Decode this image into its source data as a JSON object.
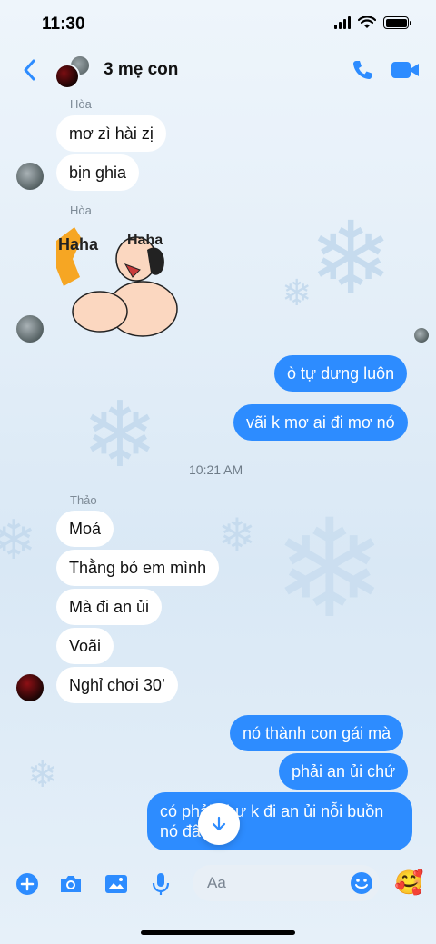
{
  "status_bar": {
    "time": "11:30"
  },
  "header": {
    "title": "3 mẹ con"
  },
  "messages": {
    "hoa_name_1": "Hòa",
    "hoa_1": "mơ zì hài zị",
    "hoa_2": "bịn ghia",
    "hoa_name_2": "Hòa",
    "out_1": "ò tự dưng luôn",
    "out_2": "vãi k mơ ai đi mơ nó",
    "timestamp": "10:21 AM",
    "thao_name": "Thảo",
    "thao_1": "Moá",
    "thao_2": "Thằng bỏ em mình",
    "thao_3": "Mà đi an ủi",
    "thao_4": "Voãi",
    "thao_5": "Nghỉ chơi 30’",
    "out_3": "nó thành con gái mà",
    "out_4": "phải an ủi chứ",
    "out_5_line1": "có phải như k đi an ủi nỗi buồn",
    "out_5_line2": "nó đâu"
  },
  "sticker": {
    "text": "Haha"
  },
  "composer": {
    "placeholder": "Aa",
    "quick_reaction": "🥰"
  },
  "colors": {
    "accent": "#2d8cff",
    "incoming": "#ffffff",
    "background": "#e3eef8"
  }
}
